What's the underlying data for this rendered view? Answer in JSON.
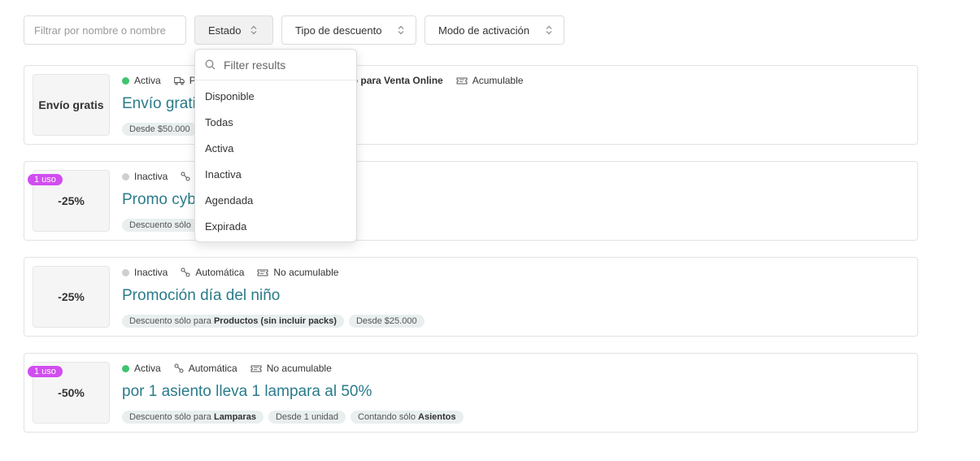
{
  "filters": {
    "search_placeholder": "Filtrar por nombre o nombre",
    "estado_label": "Estado",
    "tipo_label": "Tipo de descuento",
    "modo_label": "Modo de activación"
  },
  "dropdown": {
    "search_placeholder": "Filter results",
    "options": [
      "Disponible",
      "Todas",
      "Activa",
      "Inactiva",
      "Agendada",
      "Expirada"
    ]
  },
  "cards": [
    {
      "thumb": "Envío gratis",
      "status": "Activa",
      "meta_truncated": "P",
      "meta_bold": "o para Venta Online",
      "meta_extra": "Acumulable",
      "title": "Envío grati",
      "tags": [
        "Desde $50.000"
      ]
    },
    {
      "badge": "1 uso",
      "thumb": "-25%",
      "status": "Inactiva",
      "title": "Promo cyb",
      "tags": [
        "Descuento sólo"
      ]
    },
    {
      "thumb": "-25%",
      "status": "Inactiva",
      "activation": "Automática",
      "stack": "No acumulable",
      "title": "Promoción día del niño",
      "tag1_prefix": "Descuento sólo para",
      "tag1_bold": "Productos (sin incluir packs)",
      "tag2": "Desde $25.000"
    },
    {
      "badge": "1 uso",
      "thumb": "-50%",
      "status": "Activa",
      "activation": "Automática",
      "stack": "No acumulable",
      "title": "por 1 asiento lleva 1 lampara al 50%",
      "tag1_prefix": "Descuento sólo para",
      "tag1_bold": "Lamparas",
      "tag2": "Desde 1 unidad",
      "tag3_prefix": "Contando sólo",
      "tag3_bold": "Asientos"
    }
  ],
  "colors": {
    "accent_title": "#2a7b8a",
    "active_dot": "#3ec46d",
    "inactive_dot": "#cfcfcf",
    "badge": "#d14df0"
  }
}
